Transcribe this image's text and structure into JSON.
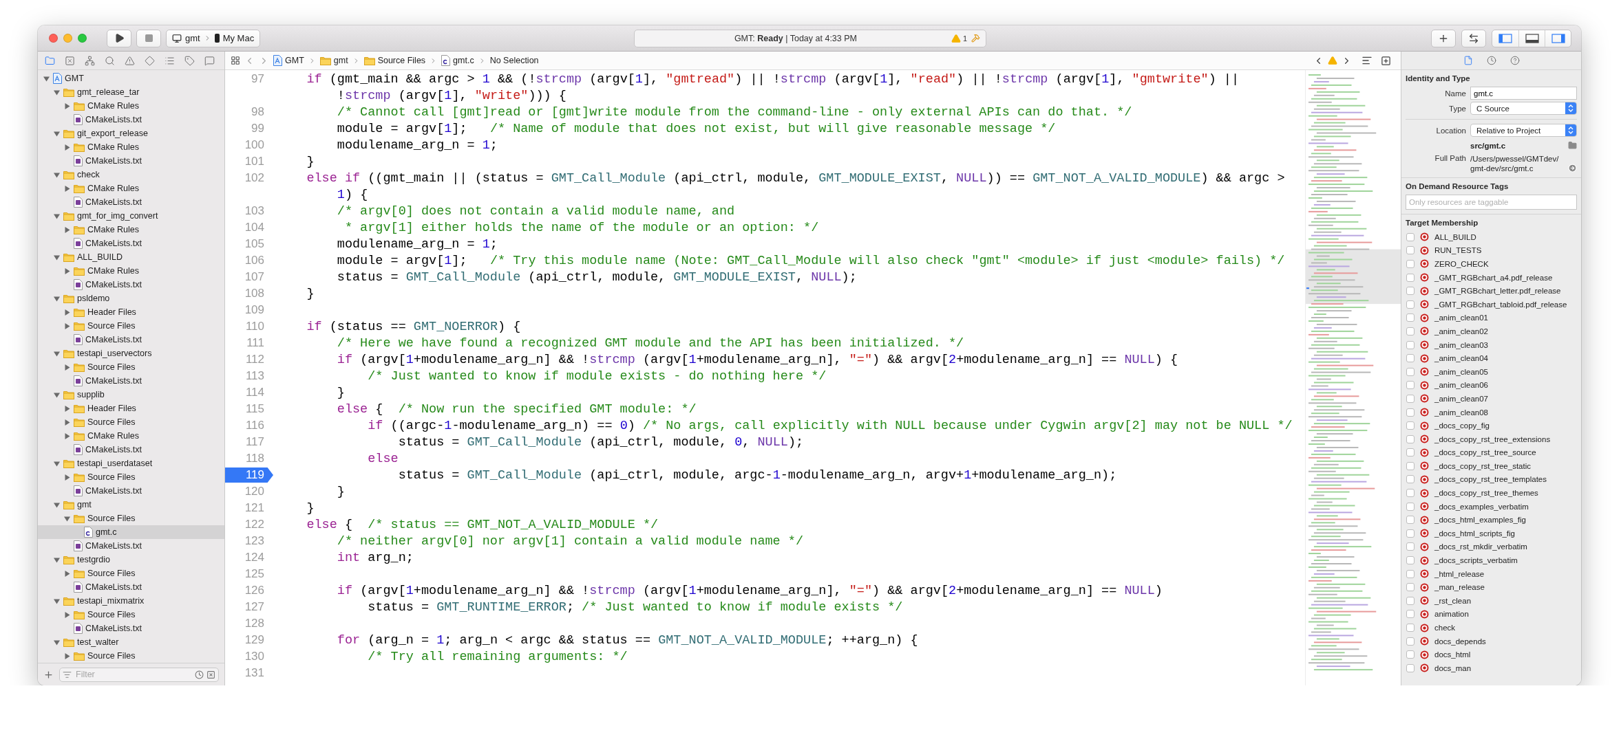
{
  "toolbar": {
    "scheme": {
      "target": "gmt",
      "destination": "My Mac"
    },
    "activity": {
      "status": "GMT: **Ready** | Today at 4:33 PM",
      "warning_count": "1"
    },
    "panels": [
      {
        "on": true
      },
      {
        "on": false
      },
      {
        "on": true
      }
    ]
  },
  "navigator": {
    "tabs": [
      {
        "selected": true
      },
      {
        "selected": false
      },
      {
        "selected": false
      },
      {
        "selected": false
      },
      {
        "selected": false
      },
      {
        "selected": false
      },
      {
        "selected": false
      },
      {
        "selected": false
      },
      {
        "selected": false
      }
    ],
    "tree": [
      {
        "label": "GMT",
        "kind": "project",
        "expanded": true,
        "selected": false,
        "children": [
          {
            "label": "gmt_release_tar",
            "kind": "folder",
            "expanded": true,
            "selected": false,
            "children": [
              {
                "label": "CMake Rules",
                "kind": "folder",
                "expanded": false,
                "selected": false
              },
              {
                "label": "CMakeLists.txt",
                "kind": "cmake",
                "selected": false
              }
            ]
          },
          {
            "label": "git_export_release",
            "kind": "folder",
            "expanded": true,
            "selected": false,
            "children": [
              {
                "label": "CMake Rules",
                "kind": "folder",
                "expanded": false,
                "selected": false
              },
              {
                "label": "CMakeLists.txt",
                "kind": "cmake",
                "selected": false
              }
            ]
          },
          {
            "label": "check",
            "kind": "folder",
            "expanded": true,
            "selected": false,
            "children": [
              {
                "label": "CMake Rules",
                "kind": "folder",
                "expanded": false,
                "selected": false
              },
              {
                "label": "CMakeLists.txt",
                "kind": "cmake",
                "selected": false
              }
            ]
          },
          {
            "label": "gmt_for_img_convert",
            "kind": "folder",
            "expanded": true,
            "selected": false,
            "children": [
              {
                "label": "CMake Rules",
                "kind": "folder",
                "expanded": false,
                "selected": false
              },
              {
                "label": "CMakeLists.txt",
                "kind": "cmake",
                "selected": false
              }
            ]
          },
          {
            "label": "ALL_BUILD",
            "kind": "folder",
            "expanded": true,
            "selected": false,
            "children": [
              {
                "label": "CMake Rules",
                "kind": "folder",
                "expanded": false,
                "selected": false
              },
              {
                "label": "CMakeLists.txt",
                "kind": "cmake",
                "selected": false
              }
            ]
          },
          {
            "label": "psldemo",
            "kind": "folder",
            "expanded": true,
            "selected": false,
            "children": [
              {
                "label": "Header Files",
                "kind": "folder",
                "expanded": false,
                "selected": false
              },
              {
                "label": "Source Files",
                "kind": "folder",
                "expanded": false,
                "selected": false
              },
              {
                "label": "CMakeLists.txt",
                "kind": "cmake",
                "selected": false
              }
            ]
          },
          {
            "label": "testapi_uservectors",
            "kind": "folder",
            "expanded": true,
            "selected": false,
            "children": [
              {
                "label": "Source Files",
                "kind": "folder",
                "expanded": false,
                "selected": false
              },
              {
                "label": "CMakeLists.txt",
                "kind": "cmake",
                "selected": false
              }
            ]
          },
          {
            "label": "supplib",
            "kind": "folder",
            "expanded": true,
            "selected": false,
            "children": [
              {
                "label": "Header Files",
                "kind": "folder",
                "expanded": false,
                "selected": false
              },
              {
                "label": "Source Files",
                "kind": "folder",
                "expanded": false,
                "selected": false
              },
              {
                "label": "CMake Rules",
                "kind": "folder",
                "expanded": false,
                "selected": false
              },
              {
                "label": "CMakeLists.txt",
                "kind": "cmake",
                "selected": false
              }
            ]
          },
          {
            "label": "testapi_userdataset",
            "kind": "folder",
            "expanded": true,
            "selected": false,
            "children": [
              {
                "label": "Source Files",
                "kind": "folder",
                "expanded": false,
                "selected": false
              },
              {
                "label": "CMakeLists.txt",
                "kind": "cmake",
                "selected": false
              }
            ]
          },
          {
            "label": "gmt",
            "kind": "folder",
            "expanded": true,
            "selected": false,
            "children": [
              {
                "label": "Source Files",
                "kind": "folder",
                "expanded": true,
                "selected": false,
                "children": [
                  {
                    "label": "gmt.c",
                    "kind": "source",
                    "selected": true
                  }
                ]
              },
              {
                "label": "CMakeLists.txt",
                "kind": "cmake",
                "selected": false
              }
            ]
          },
          {
            "label": "testgrdio",
            "kind": "folder",
            "expanded": true,
            "selected": false,
            "children": [
              {
                "label": "Source Files",
                "kind": "folder",
                "expanded": false,
                "selected": false
              },
              {
                "label": "CMakeLists.txt",
                "kind": "cmake",
                "selected": false
              }
            ]
          },
          {
            "label": "testapi_mixmatrix",
            "kind": "folder",
            "expanded": true,
            "selected": false,
            "children": [
              {
                "label": "Source Files",
                "kind": "folder",
                "expanded": false,
                "selected": false
              },
              {
                "label": "CMakeLists.txt",
                "kind": "cmake",
                "selected": false
              }
            ]
          },
          {
            "label": "test_walter",
            "kind": "folder",
            "expanded": true,
            "selected": false,
            "children": [
              {
                "label": "Source Files",
                "kind": "folder",
                "expanded": false,
                "selected": false
              }
            ]
          }
        ]
      }
    ],
    "filter": {
      "placeholder": "Filter"
    }
  },
  "editor": {
    "breadcrumbs": [
      {
        "label": "GMT",
        "kind": "project"
      },
      {
        "label": "gmt",
        "kind": "folder"
      },
      {
        "label": "Source Files",
        "kind": "folder"
      },
      {
        "label": "gmt.c",
        "kind": "source"
      },
      {
        "label": "No Selection",
        "kind": "none"
      }
    ],
    "lines": [
      {
        "number": "97",
        "breakpoint": false,
        "segments": [
          {
            "kind": "keyword",
            "text": "    if"
          },
          {
            "kind": "plain",
            "text": " (gmt_main && argc > "
          },
          {
            "kind": "number",
            "text": "1"
          },
          {
            "kind": "plain",
            "text": " && (!"
          },
          {
            "kind": "library",
            "text": "strcmp"
          },
          {
            "kind": "plain",
            "text": " (argv["
          },
          {
            "kind": "number",
            "text": "1"
          },
          {
            "kind": "plain",
            "text": "], "
          },
          {
            "kind": "string",
            "text": "\"gmtread\""
          },
          {
            "kind": "plain",
            "text": ") || !"
          },
          {
            "kind": "library",
            "text": "strcmp"
          },
          {
            "kind": "plain",
            "text": " (argv["
          },
          {
            "kind": "number",
            "text": "1"
          },
          {
            "kind": "plain",
            "text": "], "
          },
          {
            "kind": "string",
            "text": "\"read\""
          },
          {
            "kind": "plain",
            "text": ") || !"
          },
          {
            "kind": "library",
            "text": "strcmp"
          },
          {
            "kind": "plain",
            "text": " (argv["
          },
          {
            "kind": "number",
            "text": "1"
          },
          {
            "kind": "plain",
            "text": "], "
          },
          {
            "kind": "string",
            "text": "\"gmtwrite\""
          },
          {
            "kind": "plain",
            "text": ") ||"
          }
        ]
      },
      {
        "segments": [
          {
            "kind": "plain",
            "text": "        !"
          },
          {
            "kind": "library",
            "text": "strcmp"
          },
          {
            "kind": "plain",
            "text": " (argv["
          },
          {
            "kind": "number",
            "text": "1"
          },
          {
            "kind": "plain",
            "text": "], "
          },
          {
            "kind": "string",
            "text": "\"write\""
          },
          {
            "kind": "plain",
            "text": "))) {"
          }
        ]
      },
      {
        "number": "98",
        "breakpoint": false,
        "segments": [
          {
            "kind": "comment",
            "text": "        /* Cannot call [gmt]read or [gmt]write module from the command-line - only external APIs can do that. */"
          }
        ]
      },
      {
        "number": "99",
        "breakpoint": false,
        "segments": [
          {
            "kind": "plain",
            "text": "        module = argv["
          },
          {
            "kind": "number",
            "text": "1"
          },
          {
            "kind": "plain",
            "text": "];   "
          },
          {
            "kind": "comment",
            "text": "/* Name of module that does not exist, but will give reasonable message */"
          }
        ]
      },
      {
        "number": "100",
        "breakpoint": false,
        "segments": [
          {
            "kind": "plain",
            "text": "        modulename_arg_n = "
          },
          {
            "kind": "number",
            "text": "1"
          },
          {
            "kind": "plain",
            "text": ";"
          }
        ]
      },
      {
        "number": "101",
        "breakpoint": false,
        "segments": [
          {
            "kind": "plain",
            "text": "    }"
          }
        ]
      },
      {
        "number": "102",
        "breakpoint": false,
        "segments": [
          {
            "kind": "keyword",
            "text": "    else if"
          },
          {
            "kind": "plain",
            "text": " ((gmt_main || (status = "
          },
          {
            "kind": "macro",
            "text": "GMT_Call_Module"
          },
          {
            "kind": "plain",
            "text": " (api_ctrl, module, "
          },
          {
            "kind": "macro",
            "text": "GMT_MODULE_EXIST"
          },
          {
            "kind": "plain",
            "text": ", "
          },
          {
            "kind": "library",
            "text": "NULL"
          },
          {
            "kind": "plain",
            "text": ")) == "
          },
          {
            "kind": "macro",
            "text": "GMT_NOT_A_VALID_MODULE"
          },
          {
            "kind": "plain",
            "text": ") && argc >"
          }
        ]
      },
      {
        "segments": [
          {
            "kind": "number",
            "text": "        1"
          },
          {
            "kind": "plain",
            "text": ") {"
          }
        ]
      },
      {
        "number": "103",
        "breakpoint": false,
        "segments": [
          {
            "kind": "comment",
            "text": "        /* argv[0] does not contain a valid module name, and"
          }
        ]
      },
      {
        "number": "104",
        "breakpoint": false,
        "segments": [
          {
            "kind": "comment",
            "text": "         * argv[1] either holds the name of the module or an option: */"
          }
        ]
      },
      {
        "number": "105",
        "breakpoint": false,
        "segments": [
          {
            "kind": "plain",
            "text": "        modulename_arg_n = "
          },
          {
            "kind": "number",
            "text": "1"
          },
          {
            "kind": "plain",
            "text": ";"
          }
        ]
      },
      {
        "number": "106",
        "breakpoint": false,
        "segments": [
          {
            "kind": "plain",
            "text": "        module = argv["
          },
          {
            "kind": "number",
            "text": "1"
          },
          {
            "kind": "plain",
            "text": "];   "
          },
          {
            "kind": "comment",
            "text": "/* Try this module name (Note: GMT_Call_Module will also check \"gmt\" <module> if just <module> fails) */"
          }
        ]
      },
      {
        "number": "107",
        "breakpoint": false,
        "segments": [
          {
            "kind": "plain",
            "text": "        status = "
          },
          {
            "kind": "macro",
            "text": "GMT_Call_Module"
          },
          {
            "kind": "plain",
            "text": " (api_ctrl, module, "
          },
          {
            "kind": "macro",
            "text": "GMT_MODULE_EXIST"
          },
          {
            "kind": "plain",
            "text": ", "
          },
          {
            "kind": "library",
            "text": "NULL"
          },
          {
            "kind": "plain",
            "text": ");"
          }
        ]
      },
      {
        "number": "108",
        "breakpoint": false,
        "segments": [
          {
            "kind": "plain",
            "text": "    }"
          }
        ]
      },
      {
        "number": "109",
        "breakpoint": false
      },
      {
        "number": "110",
        "breakpoint": false,
        "segments": [
          {
            "kind": "keyword",
            "text": "    if"
          },
          {
            "kind": "plain",
            "text": " (status == "
          },
          {
            "kind": "macro",
            "text": "GMT_NOERROR"
          },
          {
            "kind": "plain",
            "text": ") {"
          }
        ]
      },
      {
        "number": "111",
        "breakpoint": false,
        "segments": [
          {
            "kind": "comment",
            "text": "        /* Here we have found a recognized GMT module and the API has been initialized. */"
          }
        ]
      },
      {
        "number": "112",
        "breakpoint": false,
        "segments": [
          {
            "kind": "keyword",
            "text": "        if"
          },
          {
            "kind": "plain",
            "text": " (argv["
          },
          {
            "kind": "number",
            "text": "1"
          },
          {
            "kind": "plain",
            "text": "+modulename_arg_n] && !"
          },
          {
            "kind": "library",
            "text": "strcmp"
          },
          {
            "kind": "plain",
            "text": " (argv["
          },
          {
            "kind": "number",
            "text": "1"
          },
          {
            "kind": "plain",
            "text": "+modulename_arg_n], "
          },
          {
            "kind": "string",
            "text": "\"=\""
          },
          {
            "kind": "plain",
            "text": ") && argv["
          },
          {
            "kind": "number",
            "text": "2"
          },
          {
            "kind": "plain",
            "text": "+modulename_arg_n] == "
          },
          {
            "kind": "library",
            "text": "NULL"
          },
          {
            "kind": "plain",
            "text": ") {"
          }
        ]
      },
      {
        "number": "113",
        "breakpoint": false,
        "segments": [
          {
            "kind": "comment",
            "text": "            /* Just wanted to know if module exists - do nothing here */"
          }
        ]
      },
      {
        "number": "114",
        "breakpoint": false,
        "segments": [
          {
            "kind": "plain",
            "text": "        }"
          }
        ]
      },
      {
        "number": "115",
        "breakpoint": false,
        "segments": [
          {
            "kind": "keyword",
            "text": "        else"
          },
          {
            "kind": "plain",
            "text": " {  "
          },
          {
            "kind": "comment",
            "text": "/* Now run the specified GMT module: */"
          }
        ]
      },
      {
        "number": "116",
        "breakpoint": false,
        "segments": [
          {
            "kind": "keyword",
            "text": "            if"
          },
          {
            "kind": "plain",
            "text": " ((argc-"
          },
          {
            "kind": "number",
            "text": "1"
          },
          {
            "kind": "plain",
            "text": "-modulename_arg_n) == "
          },
          {
            "kind": "number",
            "text": "0"
          },
          {
            "kind": "plain",
            "text": ") "
          },
          {
            "kind": "comment",
            "text": "/* No args, call explicitly with NULL because under Cygwin argv[2] may not be NULL */"
          }
        ]
      },
      {
        "number": "117",
        "breakpoint": false,
        "segments": [
          {
            "kind": "plain",
            "text": "                status = "
          },
          {
            "kind": "macro",
            "text": "GMT_Call_Module"
          },
          {
            "kind": "plain",
            "text": " (api_ctrl, module, "
          },
          {
            "kind": "number",
            "text": "0"
          },
          {
            "kind": "plain",
            "text": ", "
          },
          {
            "kind": "library",
            "text": "NULL"
          },
          {
            "kind": "plain",
            "text": ");"
          }
        ]
      },
      {
        "number": "118",
        "breakpoint": false,
        "segments": [
          {
            "kind": "keyword",
            "text": "            else"
          }
        ]
      },
      {
        "number": "119",
        "breakpoint": true,
        "segments": [
          {
            "kind": "plain",
            "text": "                status = "
          },
          {
            "kind": "macro",
            "text": "GMT_Call_Module"
          },
          {
            "kind": "plain",
            "text": " (api_ctrl, module, argc-"
          },
          {
            "kind": "number",
            "text": "1"
          },
          {
            "kind": "plain",
            "text": "-modulename_arg_n, argv+"
          },
          {
            "kind": "number",
            "text": "1"
          },
          {
            "kind": "plain",
            "text": "+modulename_arg_n);"
          }
        ]
      },
      {
        "number": "120",
        "breakpoint": false,
        "segments": [
          {
            "kind": "plain",
            "text": "        }"
          }
        ]
      },
      {
        "number": "121",
        "breakpoint": false,
        "segments": [
          {
            "kind": "plain",
            "text": "    }"
          }
        ]
      },
      {
        "number": "122",
        "breakpoint": false,
        "segments": [
          {
            "kind": "keyword",
            "text": "    else"
          },
          {
            "kind": "plain",
            "text": " {  "
          },
          {
            "kind": "comment",
            "text": "/* status == GMT_NOT_A_VALID_MODULE */"
          }
        ]
      },
      {
        "number": "123",
        "breakpoint": false,
        "segments": [
          {
            "kind": "comment",
            "text": "        /* neither argv[0] nor argv[1] contain a valid module name */"
          }
        ]
      },
      {
        "number": "124",
        "breakpoint": false,
        "segments": [
          {
            "kind": "keyword",
            "text": "        int"
          },
          {
            "kind": "plain",
            "text": " arg_n;"
          }
        ]
      },
      {
        "number": "125",
        "breakpoint": false
      },
      {
        "number": "126",
        "breakpoint": false,
        "segments": [
          {
            "kind": "keyword",
            "text": "        if"
          },
          {
            "kind": "plain",
            "text": " (argv["
          },
          {
            "kind": "number",
            "text": "1"
          },
          {
            "kind": "plain",
            "text": "+modulename_arg_n] && !"
          },
          {
            "kind": "library",
            "text": "strcmp"
          },
          {
            "kind": "plain",
            "text": " (argv["
          },
          {
            "kind": "number",
            "text": "1"
          },
          {
            "kind": "plain",
            "text": "+modulename_arg_n], "
          },
          {
            "kind": "string",
            "text": "\"=\""
          },
          {
            "kind": "plain",
            "text": ") && argv["
          },
          {
            "kind": "number",
            "text": "2"
          },
          {
            "kind": "plain",
            "text": "+modulename_arg_n] == "
          },
          {
            "kind": "library",
            "text": "NULL"
          },
          {
            "kind": "plain",
            "text": ")"
          }
        ]
      },
      {
        "number": "127",
        "breakpoint": false,
        "segments": [
          {
            "kind": "plain",
            "text": "            status = "
          },
          {
            "kind": "macro",
            "text": "GMT_RUNTIME_ERROR"
          },
          {
            "kind": "plain",
            "text": "; "
          },
          {
            "kind": "comment",
            "text": "/* Just wanted to know if module exists */"
          }
        ]
      },
      {
        "number": "128",
        "breakpoint": false
      },
      {
        "number": "129",
        "breakpoint": false,
        "segments": [
          {
            "kind": "keyword",
            "text": "        for"
          },
          {
            "kind": "plain",
            "text": " (arg_n = "
          },
          {
            "kind": "number",
            "text": "1"
          },
          {
            "kind": "plain",
            "text": "; arg_n < argc && status == "
          },
          {
            "kind": "macro",
            "text": "GMT_NOT_A_VALID_MODULE"
          },
          {
            "kind": "plain",
            "text": "; ++arg_n) {"
          }
        ]
      },
      {
        "number": "130",
        "breakpoint": false,
        "segments": [
          {
            "kind": "comment",
            "text": "            /* Try all remaining arguments: */"
          }
        ]
      },
      {
        "number": "131",
        "breakpoint": false
      }
    ]
  },
  "inspector": {
    "tabs": [
      {
        "selected": true
      },
      {
        "selected": false
      },
      {
        "selected": false
      }
    ],
    "identity": {
      "title": "Identity and Type",
      "name_label": "Name",
      "name": "gmt.c",
      "type_label": "Type",
      "type": "C Source",
      "location_label": "Location",
      "location": "Relative to Project",
      "relative_path": "src/gmt.c",
      "full_path_label": "Full Path",
      "full_path": [
        "/Users/pwessel/GMTdev/",
        "gmt-dev/src/gmt.c"
      ]
    },
    "resource_tags": {
      "title": "On Demand Resource Tags",
      "placeholder": "Only resources are taggable"
    },
    "target_membership": {
      "title": "Target Membership",
      "targets": [
        {
          "name": "ALL_BUILD",
          "checked": false
        },
        {
          "name": "RUN_TESTS",
          "checked": false
        },
        {
          "name": "ZERO_CHECK",
          "checked": false
        },
        {
          "name": "_GMT_RGBchart_a4.pdf_release",
          "checked": false
        },
        {
          "name": "_GMT_RGBchart_letter.pdf_release",
          "checked": false
        },
        {
          "name": "_GMT_RGBchart_tabloid.pdf_release",
          "checked": false
        },
        {
          "name": "_anim_clean01",
          "checked": false
        },
        {
          "name": "_anim_clean02",
          "checked": false
        },
        {
          "name": "_anim_clean03",
          "checked": false
        },
        {
          "name": "_anim_clean04",
          "checked": false
        },
        {
          "name": "_anim_clean05",
          "checked": false
        },
        {
          "name": "_anim_clean06",
          "checked": false
        },
        {
          "name": "_anim_clean07",
          "checked": false
        },
        {
          "name": "_anim_clean08",
          "checked": false
        },
        {
          "name": "_docs_copy_fig",
          "checked": false
        },
        {
          "name": "_docs_copy_rst_tree_extensions",
          "checked": false
        },
        {
          "name": "_docs_copy_rst_tree_source",
          "checked": false
        },
        {
          "name": "_docs_copy_rst_tree_static",
          "checked": false
        },
        {
          "name": "_docs_copy_rst_tree_templates",
          "checked": false
        },
        {
          "name": "_docs_copy_rst_tree_themes",
          "checked": false
        },
        {
          "name": "_docs_examples_verbatim",
          "checked": false
        },
        {
          "name": "_docs_html_examples_fig",
          "checked": false
        },
        {
          "name": "_docs_html_scripts_fig",
          "checked": false
        },
        {
          "name": "_docs_rst_mkdir_verbatim",
          "checked": false
        },
        {
          "name": "_docs_scripts_verbatim",
          "checked": false
        },
        {
          "name": "_html_release",
          "checked": false
        },
        {
          "name": "_man_release",
          "checked": false
        },
        {
          "name": "_rst_clean",
          "checked": false
        },
        {
          "name": "animation",
          "checked": false
        },
        {
          "name": "check",
          "checked": false
        },
        {
          "name": "docs_depends",
          "checked": false
        },
        {
          "name": "docs_html",
          "checked": false
        },
        {
          "name": "docs_man",
          "checked": false
        }
      ]
    }
  }
}
